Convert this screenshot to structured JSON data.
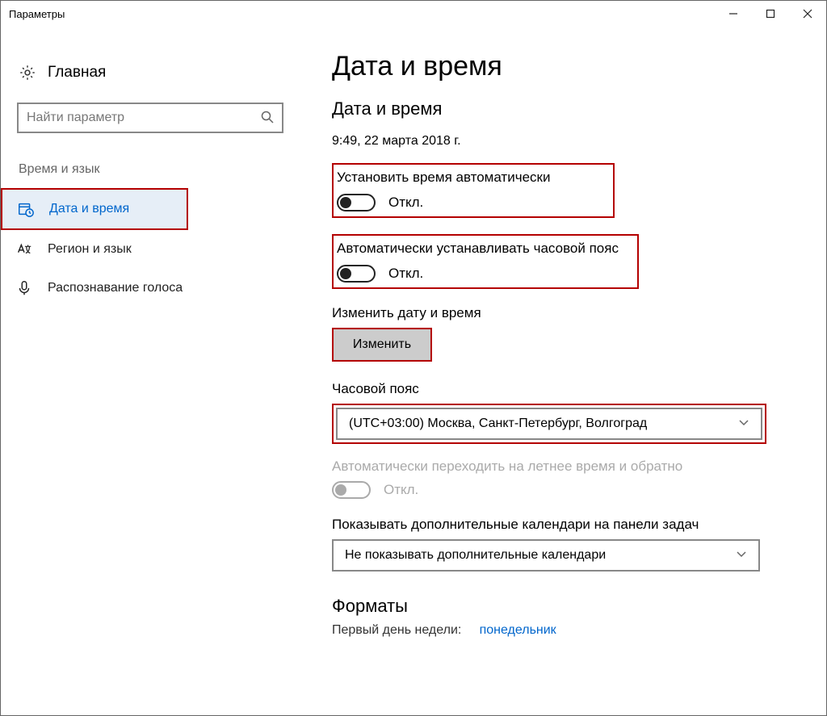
{
  "window": {
    "title": "Параметры"
  },
  "sidebar": {
    "home": "Главная",
    "search_placeholder": "Найти параметр",
    "section": "Время и язык",
    "items": [
      {
        "label": "Дата и время"
      },
      {
        "label": "Регион и язык"
      },
      {
        "label": "Распознавание голоса"
      }
    ]
  },
  "main": {
    "title": "Дата и время",
    "section1": "Дата и время",
    "current_datetime": "9:49, 22 марта 2018 г.",
    "auto_time_label": "Установить время автоматически",
    "auto_time_state": "Откл.",
    "auto_tz_label": "Автоматически устанавливать часовой пояс",
    "auto_tz_state": "Откл.",
    "change_label": "Изменить дату и время",
    "change_btn": "Изменить",
    "tz_label": "Часовой пояс",
    "tz_value": "(UTC+03:00) Москва, Санкт-Петербург, Волгоград",
    "dst_label": "Автоматически переходить на летнее время и обратно",
    "dst_state": "Откл.",
    "extra_cal_label": "Показывать дополнительные календари на панели задач",
    "extra_cal_value": "Не показывать дополнительные календари",
    "formats_heading": "Форматы",
    "cutoff_label": "Первый день недели:",
    "cutoff_value": "понедельник"
  }
}
